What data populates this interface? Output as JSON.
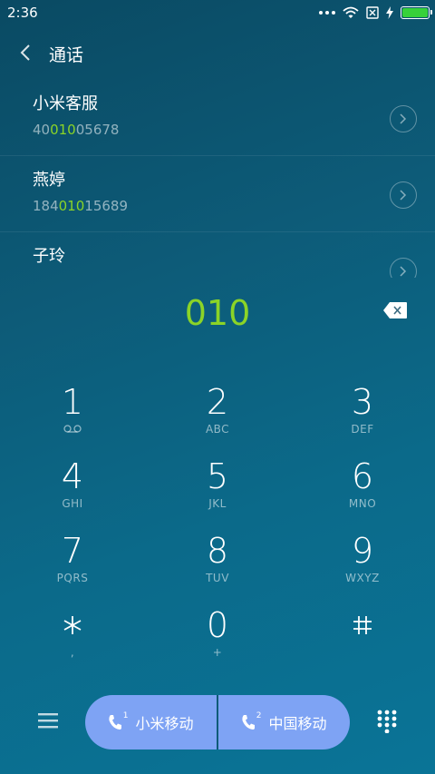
{
  "status": {
    "time": "2:36",
    "battery_color": "#37d13a"
  },
  "header": {
    "title": "通话",
    "back_icon": "chevron-left-icon"
  },
  "contacts": [
    {
      "name": "小米客服",
      "number_prefix": "40",
      "number_match": "010",
      "number_suffix": "05678"
    },
    {
      "name": "燕婷",
      "number_prefix": "184",
      "number_match": "010",
      "number_suffix": "15689"
    },
    {
      "name": "子玲",
      "number_prefix": "",
      "number_match": "",
      "number_suffix": ""
    }
  ],
  "dial": {
    "input": "010",
    "accent_color": "#8bd427"
  },
  "keypad": [
    {
      "num": "1",
      "sub": ""
    },
    {
      "num": "2",
      "sub": "ABC"
    },
    {
      "num": "3",
      "sub": "DEF"
    },
    {
      "num": "4",
      "sub": "GHI"
    },
    {
      "num": "5",
      "sub": "JKL"
    },
    {
      "num": "6",
      "sub": "MNO"
    },
    {
      "num": "7",
      "sub": "PQRS"
    },
    {
      "num": "8",
      "sub": "TUV"
    },
    {
      "num": "9",
      "sub": "WXYZ"
    },
    {
      "num": "*",
      "sub": ","
    },
    {
      "num": "0",
      "sub": "+"
    },
    {
      "num": "#",
      "sub": ""
    }
  ],
  "call": {
    "sim1_label": "小米移动",
    "sim1_index": "1",
    "sim2_label": "中国移动",
    "sim2_index": "2",
    "button_color": "#7ea3f4"
  }
}
